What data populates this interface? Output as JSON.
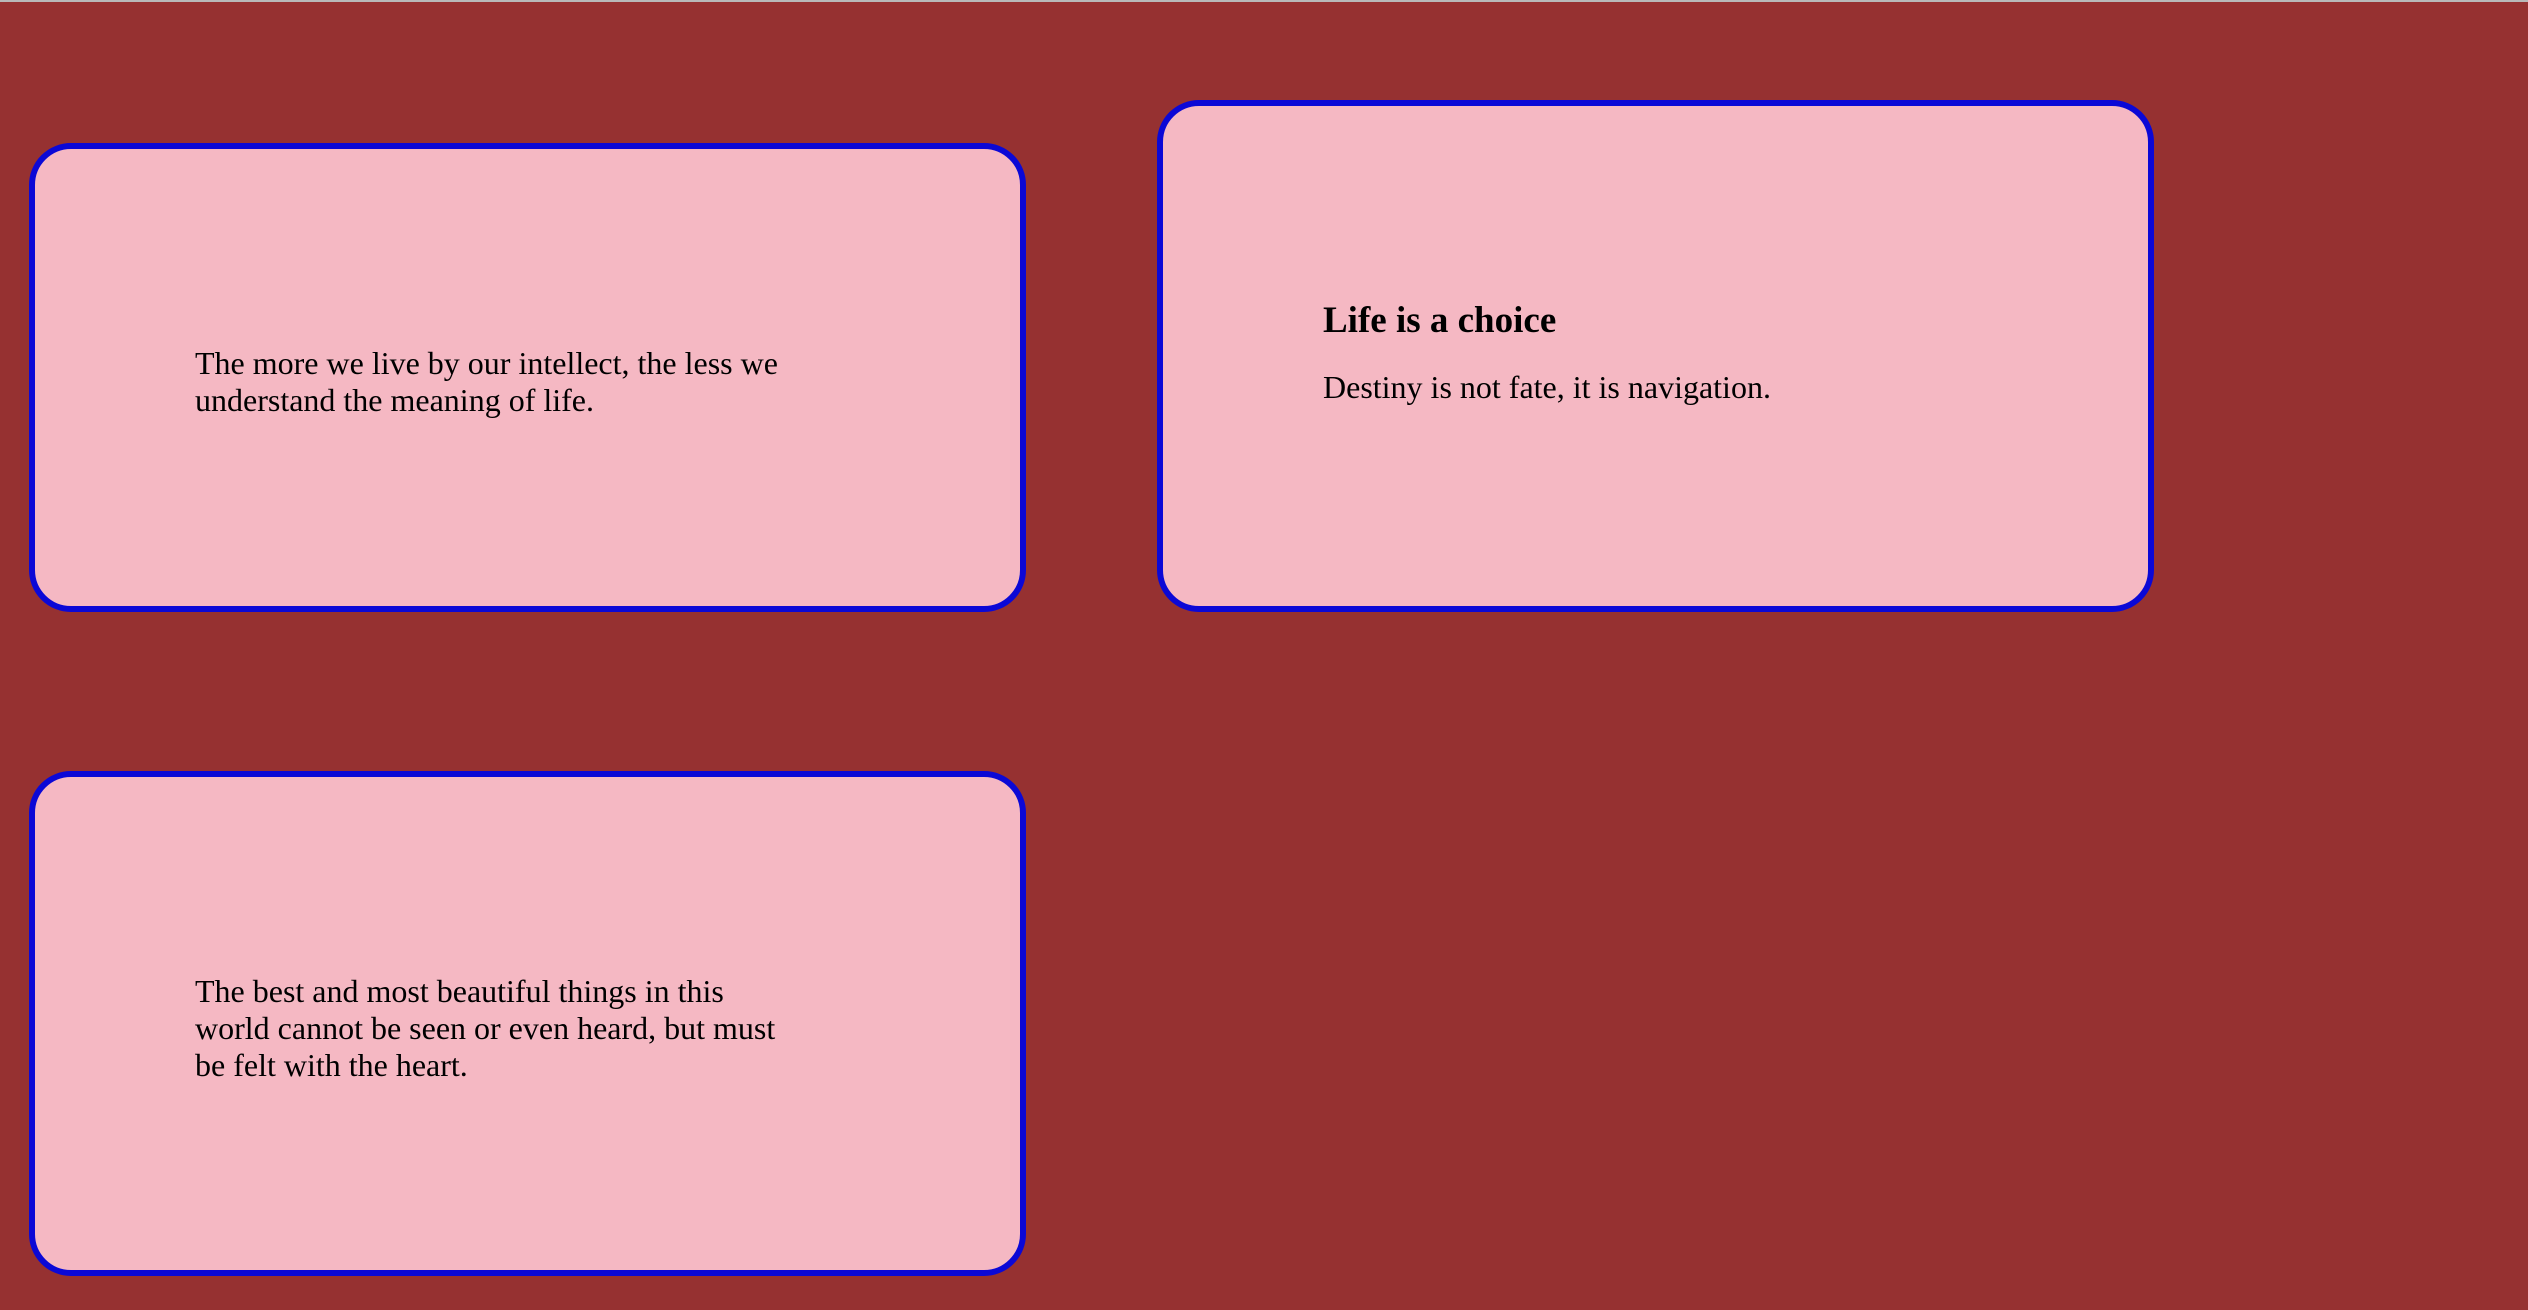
{
  "colors": {
    "background": "#963131",
    "card_fill": "#f5b8c3",
    "card_border": "#0b08d6",
    "text": "#000000"
  },
  "cards": [
    {
      "title": "",
      "text": "The more we live by our intellect, the less we understand the meaning of life."
    },
    {
      "title": "Life is a choice",
      "text": "Destiny is not fate, it is navigation."
    },
    {
      "title": "",
      "text": "The best and most beautiful things in this world cannot be seen or even heard, but must be felt with the heart."
    }
  ]
}
